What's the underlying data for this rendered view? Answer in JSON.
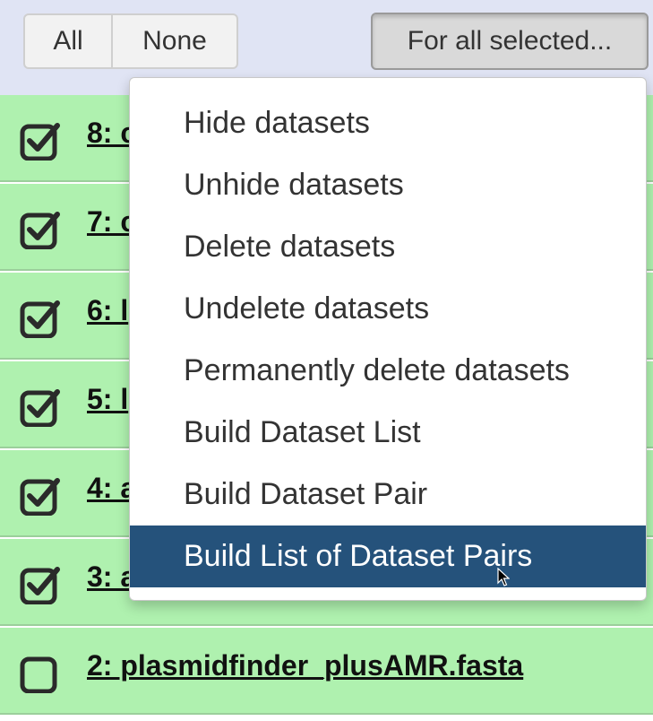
{
  "toolbar": {
    "all_label": "All",
    "none_label": "None",
    "for_all_selected_label": "For all selected..."
  },
  "datasets": [
    {
      "title": "8: c",
      "checked": true
    },
    {
      "title": "7: c",
      "checked": true
    },
    {
      "title": "6: l",
      "checked": true
    },
    {
      "title": "5: l",
      "checked": true
    },
    {
      "title": "4: a",
      "checked": true
    },
    {
      "title": "3: a",
      "checked": true
    },
    {
      "title": "2: plasmidfinder_plusAMR.fasta",
      "checked": false
    }
  ],
  "menu": {
    "items": [
      {
        "label": "Hide datasets",
        "active": false
      },
      {
        "label": "Unhide datasets",
        "active": false
      },
      {
        "label": "Delete datasets",
        "active": false
      },
      {
        "label": "Undelete datasets",
        "active": false
      },
      {
        "label": "Permanently delete datasets",
        "active": false
      },
      {
        "label": "Build Dataset List",
        "active": false
      },
      {
        "label": "Build Dataset Pair",
        "active": false
      },
      {
        "label": "Build List of Dataset Pairs",
        "active": true
      }
    ]
  },
  "colors": {
    "toolbar_bg": "#e0e4f4",
    "row_bg": "#aff1af",
    "menu_active_bg": "#25527b"
  }
}
